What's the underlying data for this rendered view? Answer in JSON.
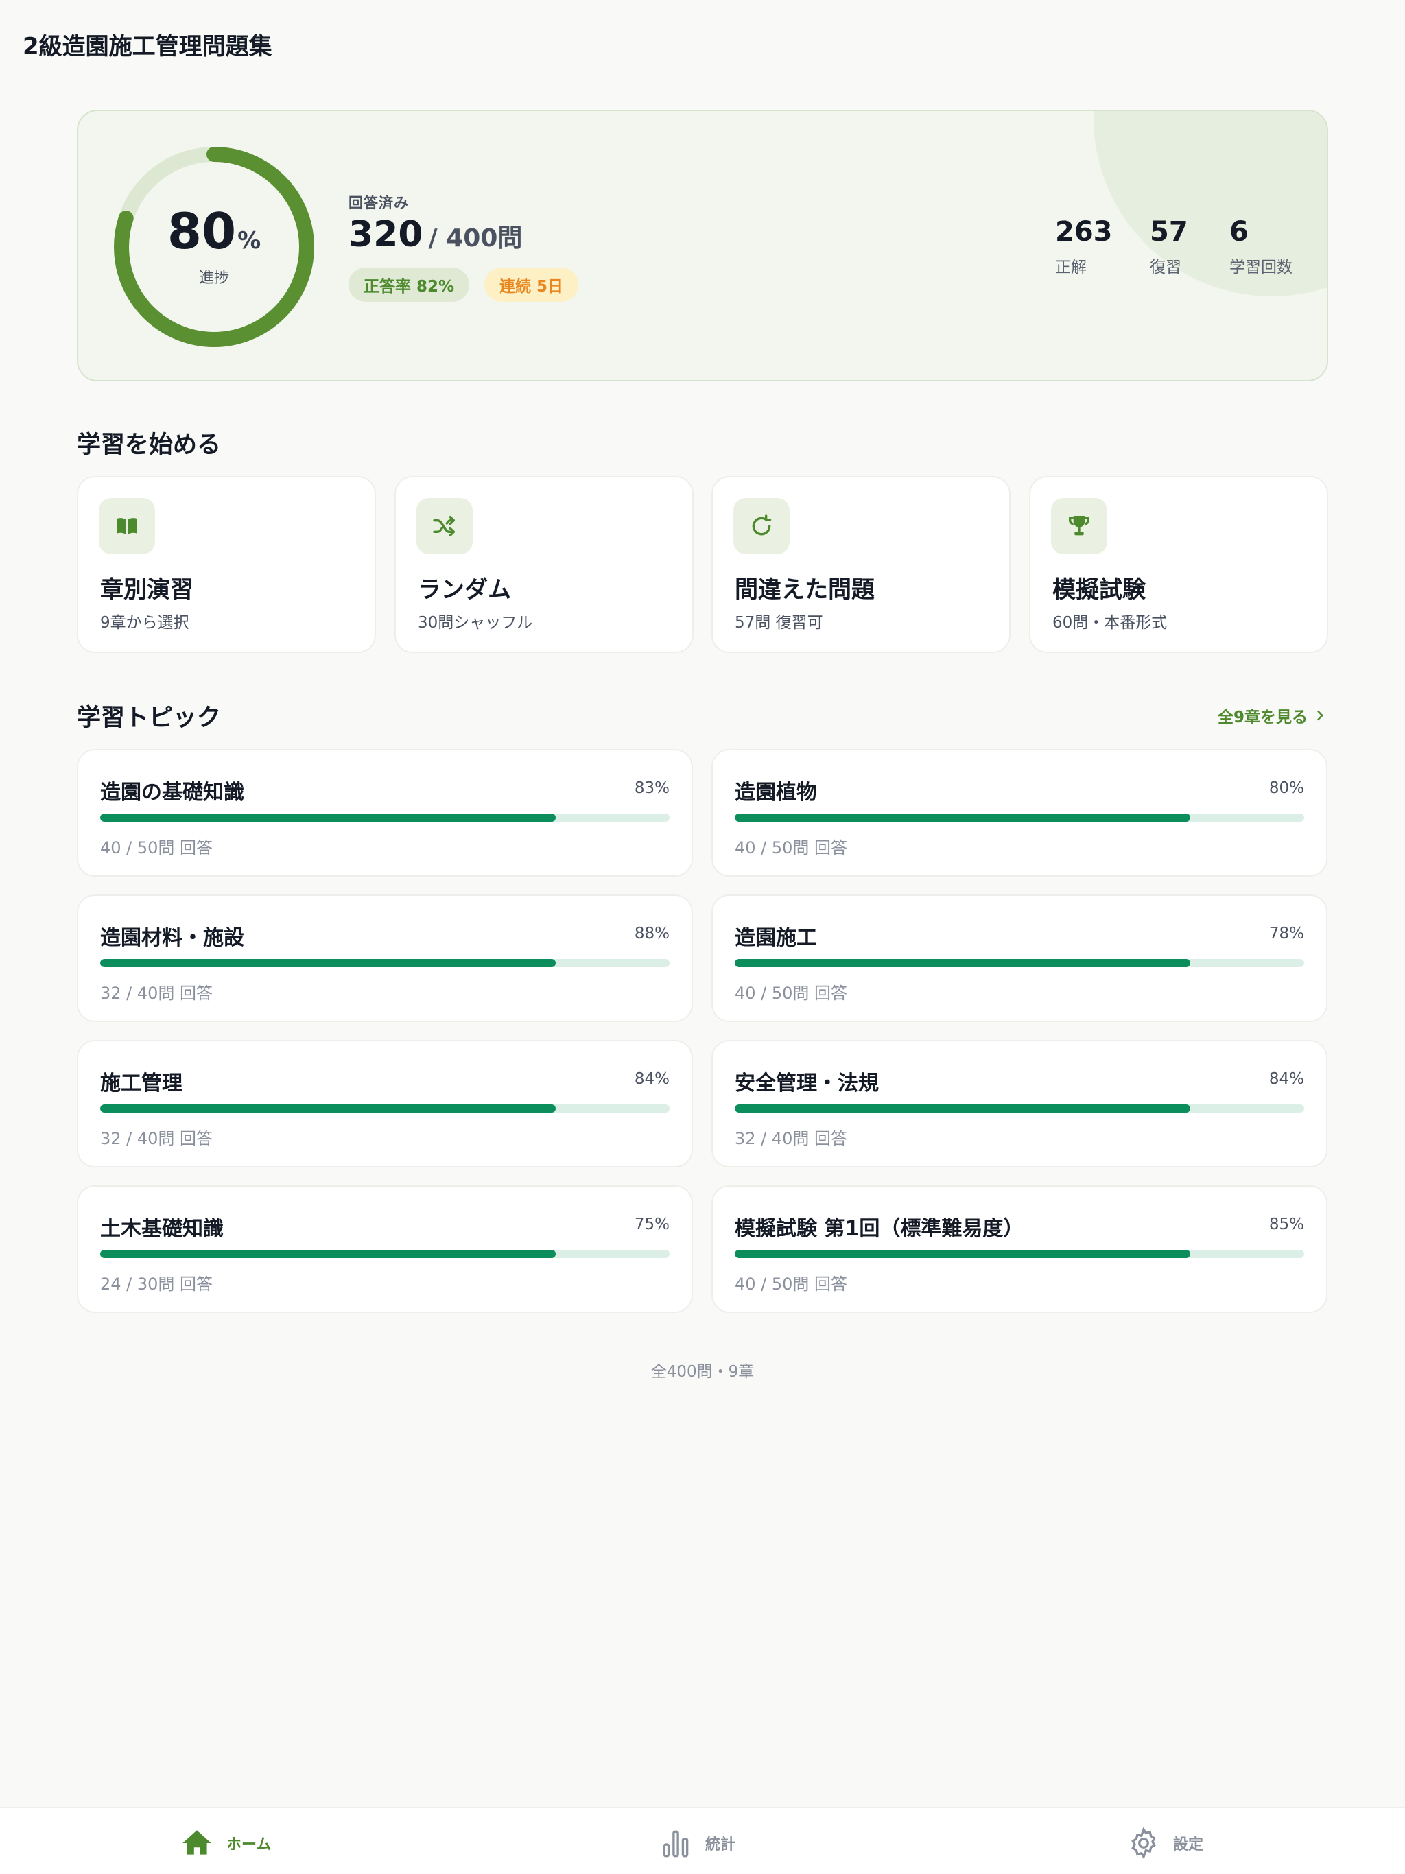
{
  "app": {
    "title": "2級造園施工管理問題集"
  },
  "summary": {
    "progress_value": 80,
    "progress_symbol": "%",
    "progress_label": "進捗",
    "answered_label": "回答済み",
    "answered": "320",
    "answered_total": "/ 400問",
    "accuracy_badge": "正答率 82%",
    "streak_badge": "連続 5日",
    "stats": [
      {
        "value": "263",
        "label": "正解"
      },
      {
        "value": "57",
        "label": "復習"
      },
      {
        "value": "6",
        "label": "学習回数"
      }
    ]
  },
  "start": {
    "heading": "学習を始める",
    "modes": [
      {
        "icon": "book-icon",
        "title": "章別演習",
        "subtitle": "9章から選択"
      },
      {
        "icon": "shuffle-icon",
        "title": "ランダム",
        "subtitle": "30問シャッフル"
      },
      {
        "icon": "retry-icon",
        "title": "間違えた問題",
        "subtitle": "57問 復習可"
      },
      {
        "icon": "trophy-icon",
        "title": "模擬試験",
        "subtitle": "60問・本番形式"
      }
    ]
  },
  "topics": {
    "heading": "学習トピック",
    "see_all": "全9章を見る",
    "items": [
      {
        "name": "造園の基礎知識",
        "percent": "83%",
        "count": "40 / 50問 回答"
      },
      {
        "name": "造園植物",
        "percent": "80%",
        "count": "40 / 50問 回答"
      },
      {
        "name": "造園材料・施設",
        "percent": "88%",
        "count": "32 / 40問 回答"
      },
      {
        "name": "造園施工",
        "percent": "78%",
        "count": "40 / 50問 回答"
      },
      {
        "name": "施工管理",
        "percent": "84%",
        "count": "32 / 40問 回答"
      },
      {
        "name": "安全管理・法規",
        "percent": "84%",
        "count": "32 / 40問 回答"
      },
      {
        "name": "土木基礎知識",
        "percent": "75%",
        "count": "24 / 30問 回答"
      },
      {
        "name": "模擬試験 第1回（標準難易度）",
        "percent": "85%",
        "count": "40 / 50問 回答"
      }
    ]
  },
  "footer_note": "全400問・9章",
  "nav": {
    "items": [
      {
        "icon": "home-icon",
        "label": "ホーム",
        "active": true
      },
      {
        "icon": "bar-chart-icon",
        "label": "統計",
        "active": false
      },
      {
        "icon": "gear-icon",
        "label": "設定",
        "active": false
      }
    ]
  },
  "colors": {
    "accent": "#5a8f32",
    "progress_track": "#dde8d3",
    "bar_fill": "#0c8d5c",
    "bar_track": "#dcefe7",
    "streak": "#e8871f"
  }
}
